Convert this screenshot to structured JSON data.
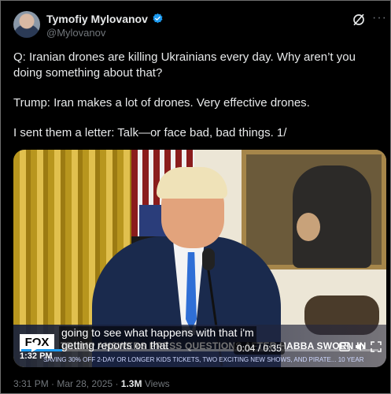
{
  "post": {
    "author_name": "Tymofiy Mylovanov",
    "author_handle": "@Mylovanov",
    "text": [
      "Q: Iranian drones are killing Ukrainians every day. Why aren’t you doing something about that?",
      "Trump: Iran makes a lot of drones. Very effective drones.",
      "I sent them a letter: Talk—or face bad, bad things. 1/"
    ],
    "time": "3:31 PM",
    "separator": "·",
    "date": "Mar 28, 2025",
    "views_count": "1.3M",
    "views_label": "Views"
  },
  "video": {
    "caption_line1": "going to see what happens with that i'm",
    "caption_line2": "getting reports on that",
    "network": "FOX",
    "headline": "TRUMP ANSWERS PRESS QUESTIONS AFTER HABBA SWORN IN",
    "ticker": "SAVING 30% OFF 2-DAY OR LONGER KIDS TICKETS, TWO EXCITING NEW SHOWS, AND PIRATE... 10 YEAR",
    "clock": "1:32 PM",
    "time_current": "0:04",
    "time_total": "0:35",
    "time_separator": "/",
    "progress": 0.114
  },
  "icons": {
    "verified": "verified-badge-icon",
    "grok": "grok-icon",
    "more": "more-options-icon",
    "play": "play-icon",
    "gif": "captions-icon",
    "volume": "volume-icon",
    "fullscreen": "fullscreen-icon"
  },
  "colors": {
    "accent": "#1d9bf0",
    "muted": "#71767b",
    "text": "#e7e9ea",
    "background": "#000000"
  }
}
